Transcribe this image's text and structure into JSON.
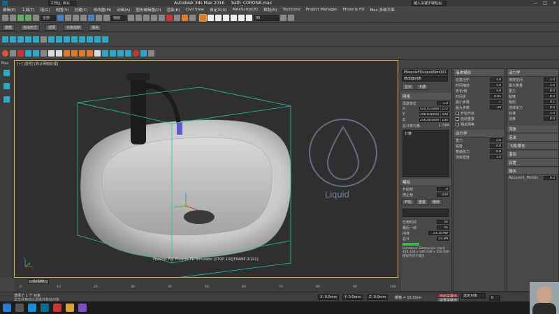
{
  "title": {
    "workspace": "工作区: 默认",
    "app": "Autodesk 3ds Max 2016",
    "file": "bath_CORONA.max",
    "search_placeholder": "键入关键字或短语"
  },
  "menu": [
    "编辑(E)",
    "工具(T)",
    "组(G)",
    "视图(V)",
    "创建(C)",
    "修改器(M)",
    "动画(A)",
    "图形编辑器(D)",
    "渲染(R)",
    "Civil View",
    "自定义(U)",
    "MAXScript(X)",
    "帮助(H)",
    "Tacticons",
    "Project Manager",
    "Phoenix FD",
    "Max 多维平面"
  ],
  "toolbar1": {
    "filter_label": "全部",
    "view_label": "视图",
    "field_value": "00"
  },
  "toolbar2": {
    "tabs": [
      "建模",
      "自由形式",
      "选择",
      "对象绘制",
      "填充"
    ]
  },
  "viewport": {
    "label": "[+] [透视] [默认明暗处理]",
    "status_text": "Phoenix FD: Phoenix FD Simulator [STOP 1/0][FRAME 0/101]",
    "watermark_text": "Liquid",
    "axis_x": "x",
    "axis_y": "y",
    "axis_z": "z"
  },
  "panel_left_col": {
    "object_name": "PhoenixFDLiquidSim001",
    "modifier_list": "修改器列表",
    "buttons": [
      "显示",
      "卡通"
    ],
    "section_title": "网格",
    "rows": [
      {
        "label": "场景单位",
        "value": "1.0"
      },
      {
        "label": "X:",
        "value": "424.433mm",
        "v2": "172"
      },
      {
        "label": "Y:",
        "value": "246.036mm",
        "v2": "100"
      },
      {
        "label": "Z:",
        "value": "256.003mm",
        "v2": "104"
      }
    ],
    "cells_label": "总计单元格",
    "cells_value": "1.79M",
    "list_items": [
      "计算"
    ],
    "section_mod": "模拟",
    "mod_rows": [
      {
        "label": "开始帧",
        "value": "0"
      },
      {
        "label": "停止帧",
        "value": "100"
      }
    ],
    "sim_buttons": [
      "开始",
      "重置",
      "继续"
    ],
    "bottom_rows": [
      {
        "label": "已用时间",
        "value": "0s"
      },
      {
        "label": "最后一帧",
        "value": "0s"
      },
      {
        "label": "内存",
        "value": "23.10 MB"
      },
      {
        "label": "总计",
        "value": "23.3M"
      }
    ],
    "bottom_buttons": [
      "Container Dimension (mm)",
      "424.434 x 246.038 x 256.000"
    ],
    "bottom_text": "模拟不同于输出"
  },
  "panel_mid_col": {
    "section_title": "液体模拟",
    "rows": [
      {
        "label": "在激活中",
        "value": "1.0"
      },
      {
        "label": "时间缩放",
        "value": "1.0"
      },
      {
        "label": "步长/帧",
        "value": "1.0"
      },
      {
        "label": "时间步",
        "value": "0.05"
      },
      {
        "label": "最小步数",
        "value": "1"
      },
      {
        "label": "最大步数",
        "value": "20"
      }
    ],
    "options": [
      "开始开启",
      "自动重置",
      "相关网格"
    ],
    "section2": "动力学",
    "rows2": [
      {
        "label": "重力",
        "value": "1.0"
      },
      {
        "label": "粘度",
        "value": "0.0"
      },
      {
        "label": "表面张力",
        "value": "0.0"
      },
      {
        "label": "流体密度",
        "value": "1.0"
      }
    ]
  },
  "panel_right_col": {
    "section_title": "动力学",
    "rows": [
      {
        "label": "液体空间",
        "value": "1.0"
      },
      {
        "label": "最大数量",
        "value": "1.0"
      },
      {
        "label": "重力",
        "value": "0.0"
      },
      {
        "label": "粘度",
        "value": "0.0"
      },
      {
        "label": "吸附",
        "value": "0.5"
      },
      {
        "label": "流体张力",
        "value": "0.0"
      },
      {
        "label": "标准",
        "value": "1.0"
      },
      {
        "label": "漂移",
        "value": "0.0"
      }
    ],
    "items": [
      "流体",
      "泡沫",
      "飞溅/雾化",
      "湿润",
      "设置",
      "输出"
    ],
    "bottom_label": "Apparent_Motion",
    "bottom_value": "0.0"
  },
  "timeline": {
    "frame": "0 / 100",
    "ticks": [
      "0",
      "10",
      "20",
      "30",
      "40",
      "50",
      "60",
      "70",
      "80",
      "90",
      "100"
    ]
  },
  "status": {
    "selection": "选择了 1 个 对象",
    "hint": "单击并拖动以选择并移动对象",
    "x": "X: 0.0mm",
    "y": "Y: 0.0mm",
    "z": "Z: 0.0mm",
    "grid": "栅格 = 10.0mm",
    "auto_key": "自动关键点",
    "set_key": "设置关键点",
    "filter": "选定对象",
    "frame_field": "0"
  },
  "left_strip_label": "Max",
  "colors": {
    "accent": "#d6b64a",
    "viewport_bg": "#2f2f2f",
    "cyan_box": "#28c4a8"
  }
}
